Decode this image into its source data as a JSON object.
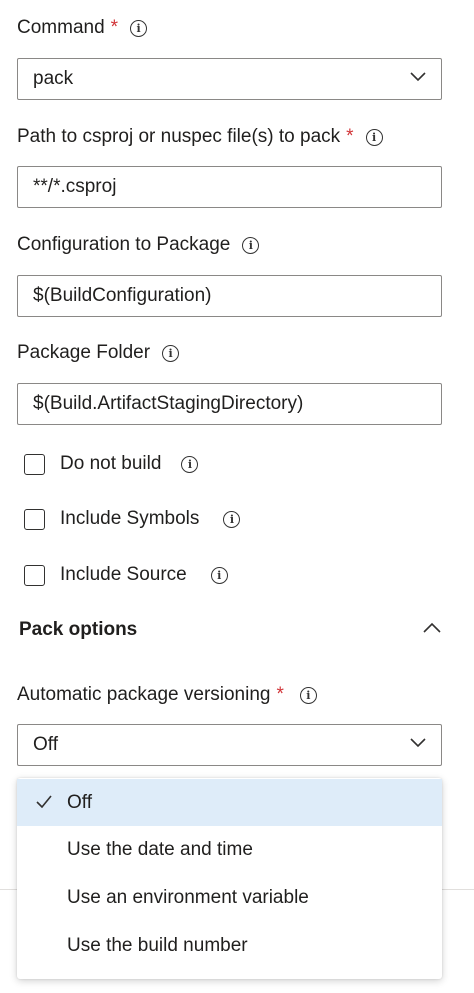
{
  "command": {
    "label": "Command",
    "required": "*",
    "value": "pack"
  },
  "path": {
    "label": "Path to csproj or nuspec file(s) to pack",
    "required": "*",
    "value": "**/*.csproj"
  },
  "configuration": {
    "label": "Configuration to Package",
    "value": "$(BuildConfiguration)"
  },
  "package_folder": {
    "label": "Package Folder",
    "value": "$(Build.ArtifactStagingDirectory)"
  },
  "checkboxes": [
    {
      "label": "Do not build",
      "checked": false
    },
    {
      "label": "Include Symbols",
      "checked": false
    },
    {
      "label": "Include Source",
      "checked": false
    }
  ],
  "pack_options": {
    "title": "Pack options",
    "expanded": true
  },
  "versioning": {
    "label": "Automatic package versioning",
    "required": "*",
    "value": "Off",
    "options": [
      {
        "label": "Off",
        "selected": true
      },
      {
        "label": "Use the date and time",
        "selected": false
      },
      {
        "label": "Use an environment variable",
        "selected": false
      },
      {
        "label": "Use the build number",
        "selected": false
      }
    ]
  },
  "icons": {
    "info": "info-icon",
    "chevron_down": "chevron-down-icon",
    "chevron_up": "chevron-up-icon",
    "check": "checkmark-icon"
  },
  "colors": {
    "required": "#d13438",
    "selected_bg": "#deecf9",
    "border": "#8a8886",
    "text": "#201f1e"
  }
}
